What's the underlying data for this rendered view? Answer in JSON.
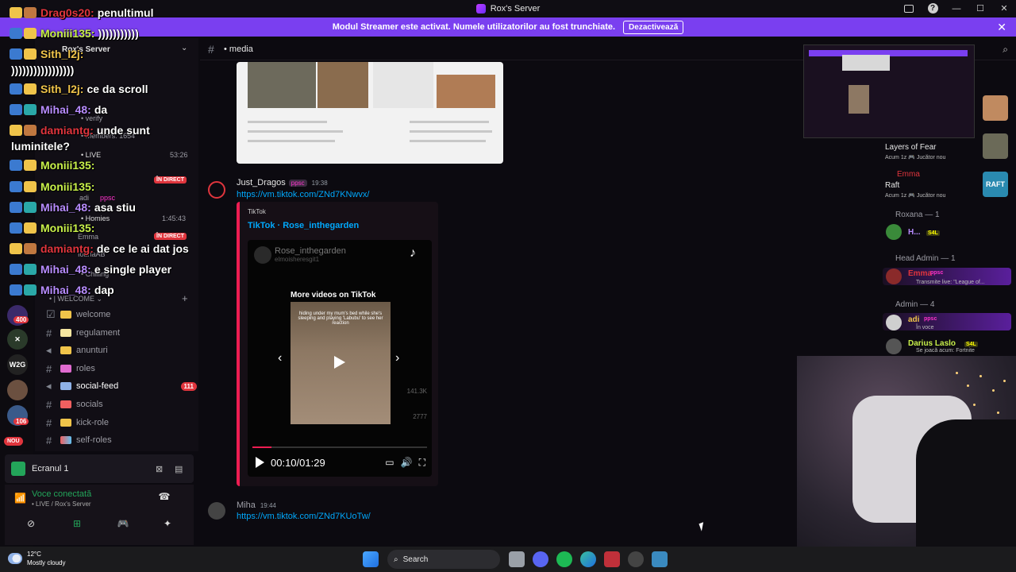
{
  "window": {
    "title": "Rox's Server",
    "help": "?"
  },
  "banner": {
    "text": "Modul Streamer este activat. Numele utilizatorilor au fost trunchiate.",
    "button": "Dezactivează",
    "close": "✕"
  },
  "server": {
    "name": "Rox's Server"
  },
  "rail": {
    "badges": [
      "400",
      "106"
    ],
    "nou": "NOU",
    "labels": {
      "w2g": "W2G"
    }
  },
  "sidebar_misc": {
    "verify": "• verify",
    "members": "• Members: 1654",
    "live": "• LIVE",
    "live_time": "53:26",
    "in_direct": "ÎN DIRECT",
    "adi": "adi",
    "ppsc": "ppsc",
    "homies": "• Homies",
    "homies_time": "1:45:43",
    "emma": "Emma",
    "ioana": "IoanaAB",
    "chilling": "• Chilling"
  },
  "channels": {
    "category": "• | WELCOME ⌄",
    "items": [
      {
        "name": "welcome",
        "count": ""
      },
      {
        "name": "regulament",
        "count": ""
      },
      {
        "name": "anunturi",
        "count": ""
      },
      {
        "name": "roles",
        "count": ""
      },
      {
        "name": "social-feed",
        "count": "111"
      },
      {
        "name": "socials",
        "count": ""
      },
      {
        "name": "kick-role",
        "count": ""
      },
      {
        "name": "self-roles",
        "count": ""
      }
    ]
  },
  "stream_chat": [
    {
      "user": "Drag0s20:",
      "msg": "penultimul",
      "color": "#e0353d"
    },
    {
      "user": "Moniii135:",
      "msg": ")))))))))))",
      "color": "#c8f04a"
    },
    {
      "user": "Sith_l2j:",
      "msg": "",
      "color": "#f0c44a"
    },
    {
      "user": "",
      "msg": ")))))))))))))))))",
      "color": "#ffffff"
    },
    {
      "user": "Sith_l2j:",
      "msg": "ce da scroll",
      "color": "#f0c44a"
    },
    {
      "user": "Mihai_48:",
      "msg": "da",
      "color": "#b88cff"
    },
    {
      "user": "damiantg:",
      "msg": "unde sunt",
      "color": "#e0353d"
    },
    {
      "user": "",
      "msg": "luminitele?",
      "color": "#ffffff"
    },
    {
      "user": "Moniii135:",
      "msg": "",
      "color": "#c8f04a"
    },
    {
      "user": "Moniii135:",
      "msg": "",
      "color": "#c8f04a"
    },
    {
      "user": "Mihai_48:",
      "msg": "asa stiu",
      "color": "#b88cff"
    },
    {
      "user": "Moniii135:",
      "msg": "",
      "color": "#c8f04a"
    },
    {
      "user": "damiantg:",
      "msg": "de ce le ai dat jos",
      "color": "#e0353d"
    },
    {
      "user": "Mihai_48:",
      "msg": "e single player",
      "color": "#b88cff"
    },
    {
      "user": "Mihai_48:",
      "msg": "dap",
      "color": "#b88cff"
    }
  ],
  "voice": {
    "screen": "Ecranul 1",
    "connected": "Voce conectată",
    "channel": "• LIVE / Rox's Server"
  },
  "header": {
    "channel": "• media"
  },
  "messages": [
    {
      "author": "Just_Dragos",
      "tag": "ppsc",
      "time": "19:38",
      "link": "https://vm.tiktok.com/ZNd7KNwvx/"
    },
    {
      "author": "Miha",
      "tag": "",
      "time": "19:44",
      "link": "https://vm.tiktok.com/ZNd7KUoTw/"
    }
  ],
  "embed": {
    "provider": "TikTok",
    "title": "TikTok · Rose_inthegarden",
    "player": {
      "account": "Rose_inthegarden",
      "handle": "elmoisheresgit1",
      "more": "More videos on TikTok",
      "caption": "hiding under my mum's bed while she's sleeping and playing 'Labubu' to see her reaction",
      "likes": "141.3K",
      "comments": "2777",
      "time": "00:10/01:29",
      "progress": 0.11
    }
  },
  "members": {
    "activity1": {
      "name": "Layers of Fear",
      "sub": "Acum 1z  🎮 Jucător nou"
    },
    "activity2_user": "Emma",
    "activity2": {
      "name": "Raft",
      "sub": "Acum 1z  🎮 Jucător nou"
    },
    "roxana_head": "Roxana — 1",
    "roxana_user": "H...",
    "roxana_tag": "S4L",
    "headadmin_head": "Head Admin — 1",
    "emma_user": "Emma",
    "emma_tag": "ppsc",
    "emma_sub": "Transmite live: \"League of...",
    "admin_head": "Admin — 4",
    "adi_user": "adi",
    "adi_tag": "ppsc",
    "adi_sub": "În voce",
    "darius_user": "Darius Laslo",
    "darius_tag": "S4L",
    "darius_sub": "Se joacă acum: Fortnite",
    "raft_label": "RAFT"
  },
  "taskbar": {
    "temp": "12°C",
    "weather": "Mostly cloudy",
    "search": "Search"
  }
}
